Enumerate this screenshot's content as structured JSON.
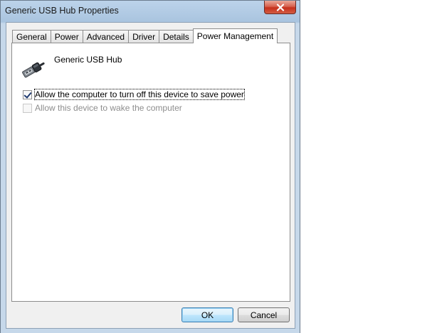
{
  "window": {
    "title": "Generic USB Hub Properties",
    "close_icon": "close-icon"
  },
  "tabs": [
    {
      "label": "General",
      "active": false
    },
    {
      "label": "Power",
      "active": false
    },
    {
      "label": "Advanced",
      "active": false
    },
    {
      "label": "Driver",
      "active": false
    },
    {
      "label": "Details",
      "active": false
    },
    {
      "label": "Power Management",
      "active": true
    }
  ],
  "device": {
    "name": "Generic USB Hub",
    "icon": "usb-plug-icon"
  },
  "options": {
    "allow_turn_off": {
      "label": "Allow the computer to turn off this device to save power",
      "checked": true,
      "enabled": true
    },
    "allow_wake": {
      "label": "Allow this device to wake the computer",
      "checked": false,
      "enabled": false
    }
  },
  "buttons": {
    "ok": "OK",
    "cancel": "Cancel"
  },
  "colors": {
    "frame": "#bcd3ea",
    "close_button": "#c5301c",
    "default_button_border": "#3c7fb1"
  }
}
